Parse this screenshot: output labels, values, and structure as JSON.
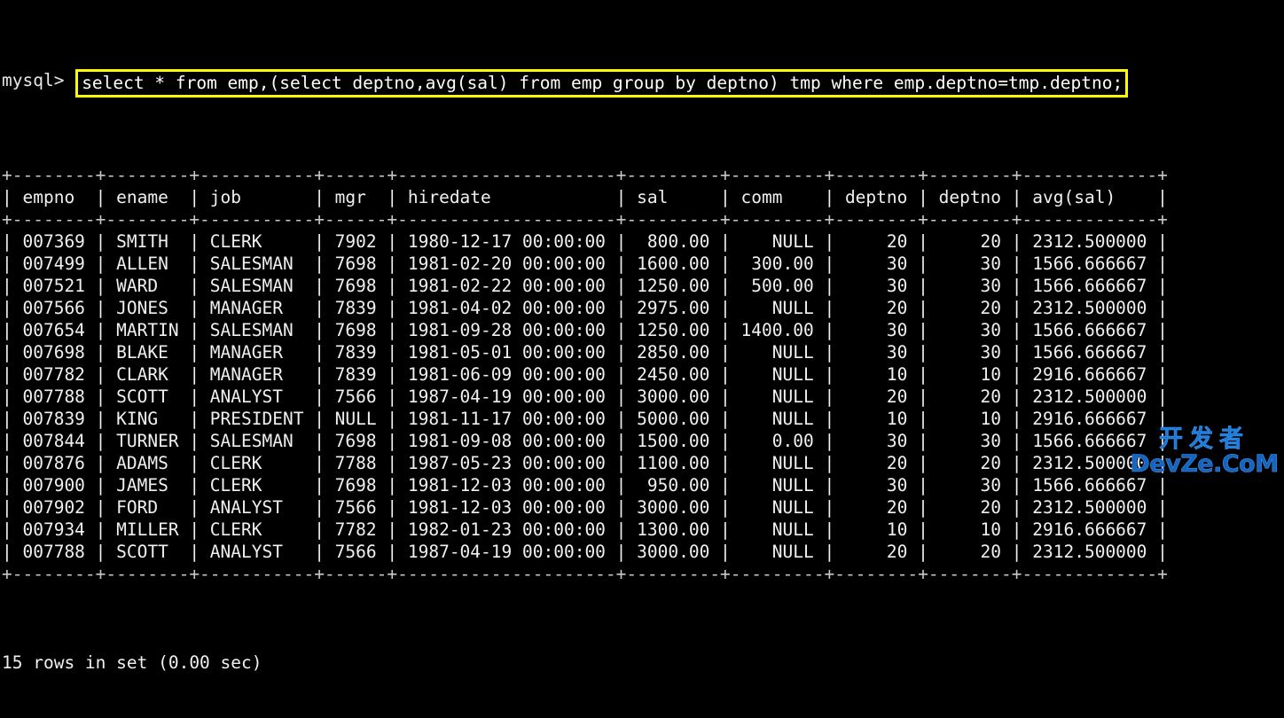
{
  "terminal": {
    "prompt": "mysql> ",
    "query": "select * from emp,(select deptno,avg(sal) from emp group by deptno) tmp where emp.deptno=tmp.deptno;",
    "highlight_color": "#ffff00",
    "background_color": "#000000",
    "text_color": "#e8e8e8",
    "status": "15 rows in set (0.00 sec)"
  },
  "table": {
    "separator": "+--------+--------+-----------+------+---------------------+---------+---------+--------+--------+-------------+",
    "columns": [
      {
        "name": "empno",
        "width": 6,
        "align": "right"
      },
      {
        "name": "ename",
        "width": 6,
        "align": "left"
      },
      {
        "name": "job",
        "width": 9,
        "align": "left"
      },
      {
        "name": "mgr",
        "width": 4,
        "align": "right"
      },
      {
        "name": "hiredate",
        "width": 19,
        "align": "left"
      },
      {
        "name": "sal",
        "width": 7,
        "align": "right"
      },
      {
        "name": "comm",
        "width": 7,
        "align": "right"
      },
      {
        "name": "deptno",
        "width": 6,
        "align": "right"
      },
      {
        "name": "deptno",
        "width": 6,
        "align": "right"
      },
      {
        "name": "avg(sal)",
        "width": 11,
        "align": "right"
      }
    ],
    "rows": [
      [
        "007369",
        "SMITH",
        "CLERK",
        "7902",
        "1980-12-17 00:00:00",
        "800.00",
        "NULL",
        "20",
        "20",
        "2312.500000"
      ],
      [
        "007499",
        "ALLEN",
        "SALESMAN",
        "7698",
        "1981-02-20 00:00:00",
        "1600.00",
        "300.00",
        "30",
        "30",
        "1566.666667"
      ],
      [
        "007521",
        "WARD",
        "SALESMAN",
        "7698",
        "1981-02-22 00:00:00",
        "1250.00",
        "500.00",
        "30",
        "30",
        "1566.666667"
      ],
      [
        "007566",
        "JONES",
        "MANAGER",
        "7839",
        "1981-04-02 00:00:00",
        "2975.00",
        "NULL",
        "20",
        "20",
        "2312.500000"
      ],
      [
        "007654",
        "MARTIN",
        "SALESMAN",
        "7698",
        "1981-09-28 00:00:00",
        "1250.00",
        "1400.00",
        "30",
        "30",
        "1566.666667"
      ],
      [
        "007698",
        "BLAKE",
        "MANAGER",
        "7839",
        "1981-05-01 00:00:00",
        "2850.00",
        "NULL",
        "30",
        "30",
        "1566.666667"
      ],
      [
        "007782",
        "CLARK",
        "MANAGER",
        "7839",
        "1981-06-09 00:00:00",
        "2450.00",
        "NULL",
        "10",
        "10",
        "2916.666667"
      ],
      [
        "007788",
        "SCOTT",
        "ANALYST",
        "7566",
        "1987-04-19 00:00:00",
        "3000.00",
        "NULL",
        "20",
        "20",
        "2312.500000"
      ],
      [
        "007839",
        "KING",
        "PRESIDENT",
        "NULL",
        "1981-11-17 00:00:00",
        "5000.00",
        "NULL",
        "10",
        "10",
        "2916.666667"
      ],
      [
        "007844",
        "TURNER",
        "SALESMAN",
        "7698",
        "1981-09-08 00:00:00",
        "1500.00",
        "0.00",
        "30",
        "30",
        "1566.666667"
      ],
      [
        "007876",
        "ADAMS",
        "CLERK",
        "7788",
        "1987-05-23 00:00:00",
        "1100.00",
        "NULL",
        "20",
        "20",
        "2312.500000"
      ],
      [
        "007900",
        "JAMES",
        "CLERK",
        "7698",
        "1981-12-03 00:00:00",
        "950.00",
        "NULL",
        "30",
        "30",
        "1566.666667"
      ],
      [
        "007902",
        "FORD",
        "ANALYST",
        "7566",
        "1981-12-03 00:00:00",
        "3000.00",
        "NULL",
        "20",
        "20",
        "2312.500000"
      ],
      [
        "007934",
        "MILLER",
        "CLERK",
        "7782",
        "1982-01-23 00:00:00",
        "1300.00",
        "NULL",
        "10",
        "10",
        "2916.666667"
      ],
      [
        "007788",
        "SCOTT",
        "ANALYST",
        "7566",
        "1987-04-19 00:00:00",
        "3000.00",
        "NULL",
        "20",
        "20",
        "2312.500000"
      ]
    ]
  },
  "watermark": {
    "chinese": "开发者",
    "latin": "DevZe.CoM",
    "color": "#1565c0"
  }
}
